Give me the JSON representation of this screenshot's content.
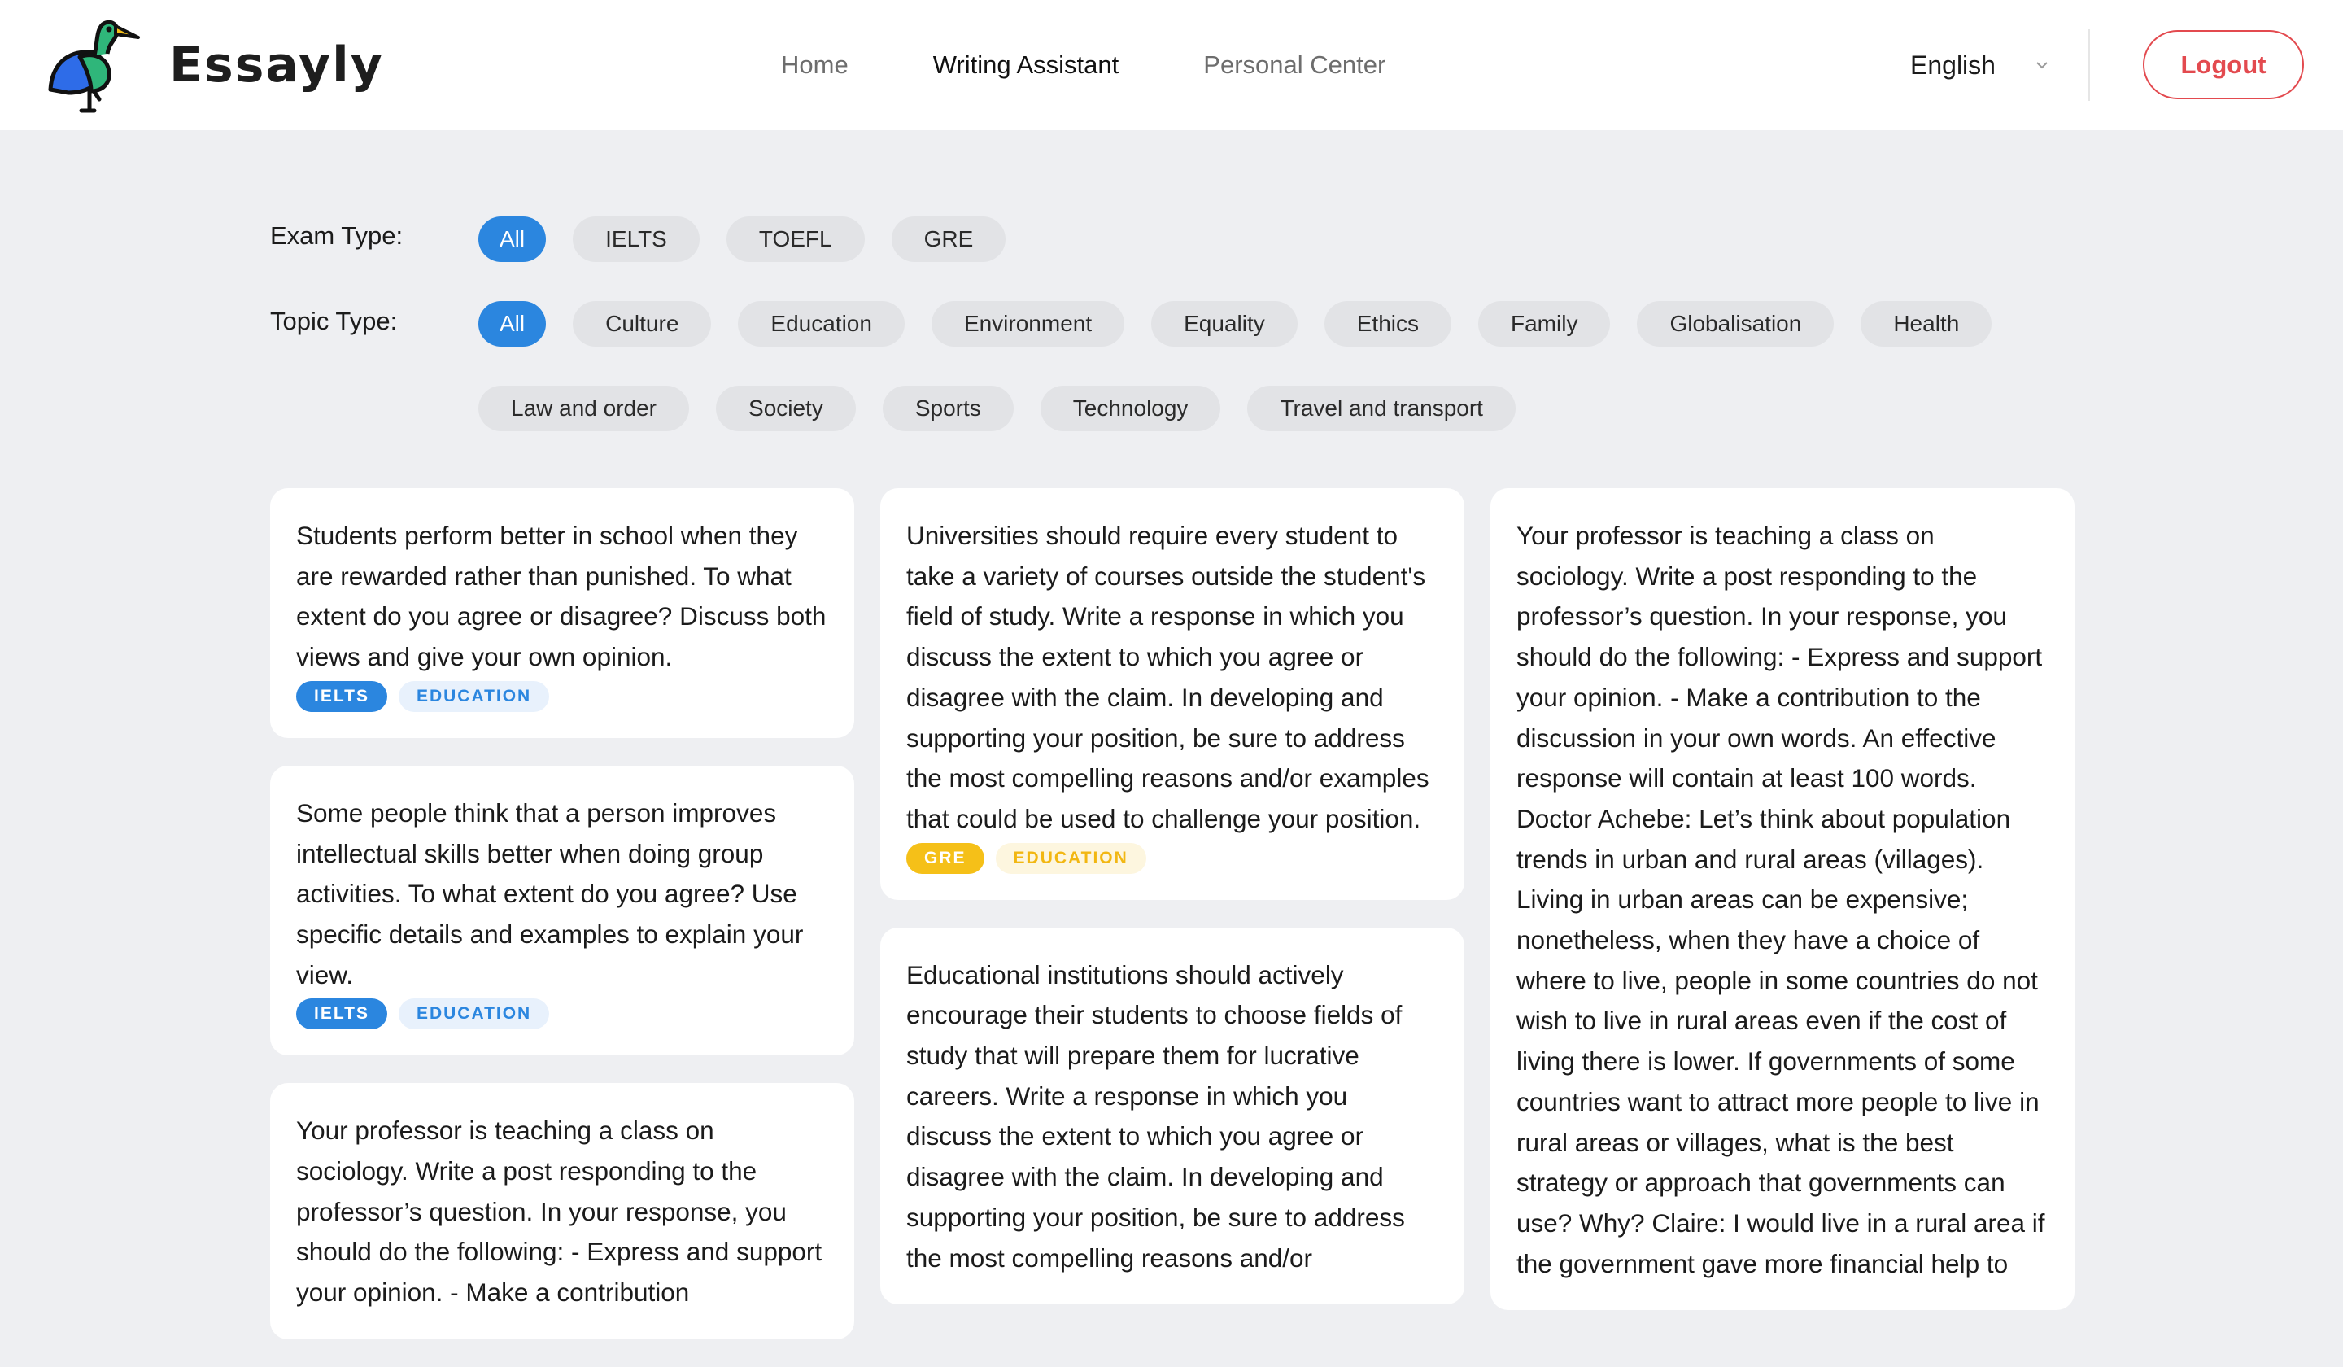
{
  "app": {
    "name": "Essayly"
  },
  "nav": {
    "items": [
      {
        "label": "Home"
      },
      {
        "label": "Writing Assistant"
      },
      {
        "label": "Personal Center"
      }
    ]
  },
  "header": {
    "language": "English",
    "logout_label": "Logout"
  },
  "filters": {
    "exam_label": "Exam Type:",
    "exam_options": [
      "All",
      "IELTS",
      "TOEFL",
      "GRE"
    ],
    "exam_selected": "All",
    "topic_label": "Topic Type:",
    "topic_options_row1": [
      "All",
      "Culture",
      "Education",
      "Environment",
      "Equality",
      "Ethics",
      "Family",
      "Globalisation",
      "Health"
    ],
    "topic_options_row2": [
      "Law and order",
      "Society",
      "Sports",
      "Technology",
      "Travel and transport"
    ],
    "topic_selected": "All"
  },
  "colors": {
    "accent_blue": "#2B86DF",
    "gre_yellow": "#F5C018",
    "logout_red": "#E34A4F",
    "page_bg": "#EEEFF2"
  },
  "cards": {
    "col1": [
      {
        "text": "Students perform better in school when they are rewarded rather than punished. To what extent do you agree or disagree? Discuss both views and give your own opinion.",
        "exam": "IELTS",
        "topic": "EDUCATION"
      },
      {
        "text": "Some people think that a person improves intellectual skills better when doing group activities. To what extent do you agree? Use specific details and examples to explain your view.",
        "exam": "IELTS",
        "topic": "EDUCATION"
      },
      {
        "text": "Your professor is teaching a class on sociology. Write a post responding to the professor’s question. In your response, you should do the following: - Express and support your opinion. - Make a contribution",
        "exam": "",
        "topic": ""
      }
    ],
    "col2": [
      {
        "text": "Universities should require every student to take a variety of courses outside the student's field of study. Write a response in which you discuss the extent to which you agree or disagree with the claim. In developing and supporting your position, be sure to address the most compelling reasons and/or examples that could be used to challenge your position.",
        "exam": "GRE",
        "topic": "EDUCATION"
      },
      {
        "text": "Educational institutions should actively encourage their students to choose fields of study that will prepare them for lucrative careers. Write a response in which you discuss the extent to which you agree or disagree with the claim. In developing and supporting your position, be sure to address the most compelling reasons and/or",
        "exam": "",
        "topic": ""
      }
    ],
    "col3": [
      {
        "text": "Your professor is teaching a class on sociology. Write a post responding to the professor’s question. In your response, you should do the following: - Express and support your opinion. - Make a contribution to the discussion in your own words. An effective response will contain at least 100 words. Doctor Achebe: Let’s think about population trends in urban and rural areas (villages). Living in urban areas can be expensive; nonetheless, when they have a choice of where to live, people in some countries do not wish to live in rural areas even if the cost of living there is lower. If governments of some countries want to attract more people to live in rural areas or villages, what is the best strategy or approach that governments can use? Why? Claire: I would live in a rural area if the government gave more financial help to",
        "exam": "",
        "topic": ""
      }
    ]
  }
}
